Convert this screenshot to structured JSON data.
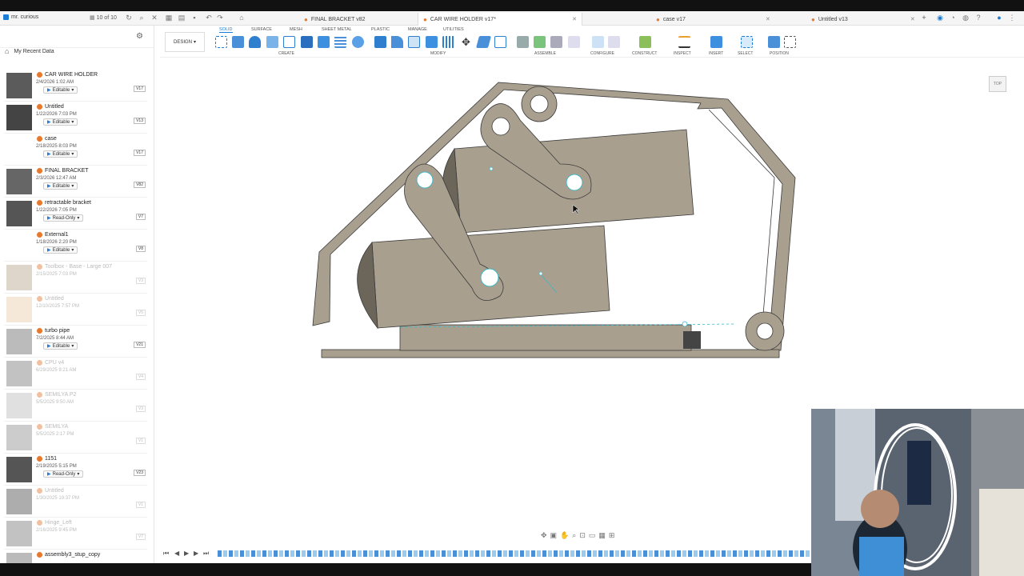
{
  "app": {
    "user_name": "mr. curious",
    "version_counter": "10 of 10"
  },
  "tabs": [
    {
      "label": "FINAL BRACKET v82",
      "active": false
    },
    {
      "label": "CAR WIRE HOLDER v17*",
      "active": true
    },
    {
      "label": "case v17",
      "active": false
    },
    {
      "label": "Untitled v13",
      "active": false
    }
  ],
  "data_panel": {
    "breadcrumb": "My Recent Data",
    "items": [
      {
        "name": "CAR WIRE HOLDER",
        "date": "2/4/2026 1:02 AM",
        "perm": "Editable",
        "ver": "V17",
        "dim": false
      },
      {
        "name": "Untitled",
        "date": "1/22/2026 7:03 PM",
        "perm": "Editable",
        "ver": "V13",
        "dim": false
      },
      {
        "name": "case",
        "date": "2/18/2025 8:03 PM",
        "perm": "Editable",
        "ver": "V17",
        "dim": false
      },
      {
        "name": "FINAL BRACKET",
        "date": "2/3/2026 12:47 AM",
        "perm": "Editable",
        "ver": "V82",
        "dim": false
      },
      {
        "name": "retractable bracket",
        "date": "1/22/2026 7:05 PM",
        "perm": "Read-Only",
        "ver": "V7",
        "dim": false
      },
      {
        "name": "External1",
        "date": "1/18/2026 2:20 PM",
        "perm": "Editable",
        "ver": "V8",
        "dim": false
      },
      {
        "name": "Toolbox - Base - Large 007",
        "date": "2/15/2025 7:03 PM",
        "perm": "",
        "ver": "V3",
        "dim": true
      },
      {
        "name": "Untitled",
        "date": "12/10/2025 7:57 PM",
        "perm": "",
        "ver": "V5",
        "dim": true
      },
      {
        "name": "turbo pipe",
        "date": "7/2/2025 8:44 AM",
        "perm": "Editable",
        "ver": "V21",
        "dim": false
      },
      {
        "name": "CPU v4",
        "date": "6/29/2025 9:21 AM",
        "perm": "",
        "ver": "V4",
        "dim": true
      },
      {
        "name": "SEMILYA P2",
        "date": "5/5/2025 9:50 AM",
        "perm": "",
        "ver": "V3",
        "dim": true
      },
      {
        "name": "SEMILYA",
        "date": "5/5/2025 2:17 PM",
        "perm": "",
        "ver": "V1",
        "dim": true
      },
      {
        "name": "1151",
        "date": "2/19/2025 5:15 PM",
        "perm": "Read-Only",
        "ver": "V23",
        "dim": false
      },
      {
        "name": "Untitled",
        "date": "1/30/2025 10:37 PM",
        "perm": "",
        "ver": "V1",
        "dim": true
      },
      {
        "name": "Hinge_Left",
        "date": "2/16/2025 9:45 PM",
        "perm": "",
        "ver": "V7",
        "dim": true
      },
      {
        "name": "assembly3_stup_copy",
        "date": "",
        "perm": "",
        "ver": "",
        "dim": false
      }
    ]
  },
  "ribbon": {
    "workspace": "DESIGN",
    "tabs": [
      "SOLID",
      "SURFACE",
      "MESH",
      "SHEET METAL",
      "PLASTIC",
      "MANAGE",
      "UTILITIES"
    ],
    "groups": [
      "CREATE",
      "MODIFY",
      "ASSEMBLE",
      "CONFIGURE",
      "CONSTRUCT",
      "INSPECT",
      "INSERT",
      "SELECT",
      "POSITION"
    ]
  },
  "viewcube": {
    "face": "TOP"
  },
  "colors": {
    "body": "#a89f8f",
    "edge": "#3a3a3a",
    "accent": "#1c7cd5",
    "sketch": "#3fb6c4"
  }
}
